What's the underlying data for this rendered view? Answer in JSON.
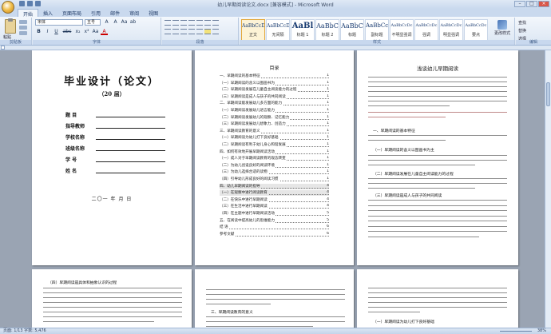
{
  "window": {
    "title": "幼儿早期阅读论文.docx [兼容模式] - Microsoft Word",
    "controls": [
      "–",
      "□",
      "×"
    ]
  },
  "tabs": [
    "开始",
    "插入",
    "页面布局",
    "引用",
    "邮件",
    "审阅",
    "视图"
  ],
  "ribbon": {
    "clipboard": {
      "paste_label": "粘贴",
      "group_label": "剪贴板"
    },
    "font": {
      "name": "宋体",
      "size": "五号",
      "group_label": "字体",
      "row1": [
        "A",
        "A",
        "Aa",
        "ab"
      ],
      "row2": [
        "B",
        "I",
        "U",
        "abc",
        "x₂",
        "x²",
        "Aa",
        "A"
      ]
    },
    "paragraph": {
      "group_label": "段落"
    },
    "styles": {
      "group_label": "样式",
      "items": [
        {
          "sample": "AaBbCcDc",
          "name": "正文"
        },
        {
          "sample": "AaBbCcDc",
          "name": "无间隔"
        },
        {
          "sample": "AaBl",
          "name": "标题 1"
        },
        {
          "sample": "AaBbC",
          "name": "标题 2"
        },
        {
          "sample": "AaBbC",
          "name": "标题"
        },
        {
          "sample": "AaBbCcl",
          "name": "副标题"
        },
        {
          "sample": "AaBbCcDc",
          "name": "不明显强调"
        },
        {
          "sample": "AaBbCcDc",
          "name": "强调"
        },
        {
          "sample": "AaBbCcDc",
          "name": "明显强调"
        },
        {
          "sample": "AaBbCcDc",
          "name": "要点"
        },
        {
          "sample": "AaBbCcDc",
          "name": "引用"
        },
        {
          "sample": "AaBbCcDc",
          "name": "明显引用"
        },
        {
          "sample": "AaBbCcDc",
          "name": "不明显参考"
        },
        {
          "sample": "AaBbCcDc",
          "name": "明显参考"
        },
        {
          "sample": "AaBbCcI",
          "name": "书籍标题"
        }
      ],
      "change_styles": "更改样式"
    },
    "editing": {
      "group_label": "编辑",
      "items": [
        "查找",
        "替换",
        "选择"
      ]
    }
  },
  "cover": {
    "title": "毕业设计（论文）",
    "year": "（20 届）",
    "fields": [
      "题    目",
      "指导教师",
      "学校名称",
      "班级名称",
      "学    号",
      "姓    名"
    ],
    "date": "二〇一  年    月    日"
  },
  "toc": {
    "title": "目录",
    "items": [
      {
        "text": "一、早期阅读的基本特征",
        "page": "1"
      },
      {
        "text": "（一）早期阅读的含义以图画书为",
        "page": "1"
      },
      {
        "text": "（二）早期阅读发展在儿童自主阅读能力的过程",
        "page": "1"
      },
      {
        "text": "（三）早期阅读是成人与孩子的共同阅读",
        "page": "1"
      },
      {
        "text": "二、早期阅读能发展幼儿多方面的能力",
        "page": "1"
      },
      {
        "text": "（一）早期阅读发展幼儿语言能力",
        "page": "1"
      },
      {
        "text": "（二）早期阅读发展幼儿的观察、记忆能力",
        "page": "1"
      },
      {
        "text": "（三）早期阅读发展幼儿想象力、创造力",
        "page": "1"
      },
      {
        "text": "三、早期阅读教育的意义",
        "page": "1"
      },
      {
        "text": "（一）早期阅读为幼儿打下良好基础",
        "page": "1"
      },
      {
        "text": "（二）早期阅读有利于幼儿身心和谐发展",
        "page": "1"
      },
      {
        "text": "四、如何有效地开展早期阅读活动",
        "page": "1"
      },
      {
        "text": "（一）成人对于早期阅读教育的观念转变",
        "page": "1"
      },
      {
        "text": "（二）为幼儿创设良好的阅读环境",
        "page": "1"
      },
      {
        "text": "（三）为幼儿选择合适的读物",
        "page": "1"
      },
      {
        "text": "（四）引导幼儿形成良好的阅读习惯",
        "page": "1"
      },
      {
        "text": "四、幼儿早期阅读的指导",
        "page": "4"
      },
      {
        "text": "（一）在观察中进行阅读教育",
        "page": "4"
      },
      {
        "text": "（二）在快乐中进行早期阅读",
        "page": "4"
      },
      {
        "text": "（三）在生活中进行早期阅读",
        "page": "4"
      },
      {
        "text": "（四）在主题中进行早期阅读活动",
        "page": "5"
      },
      {
        "text": "五、在阅读中提高幼儿的思维能力",
        "page": "5"
      },
      {
        "text": "结    语",
        "page": "6"
      },
      {
        "text": "参考文献",
        "page": "6"
      }
    ]
  },
  "article": {
    "title": "浅谈幼儿早期阅读",
    "headings": [
      "一、早期阅读的基本特征",
      "（一）早期阅读的含义以图画书为主",
      "（二）早期阅读发展在儿童自主阅读能力的过程",
      "（三）早期阅读是成人与孩子的共同阅读"
    ],
    "page4_heading": "（四）早期阅读是具体和抽象认识的过程",
    "page5_heading": "三、早期阅读教育的意义",
    "page6_heading": "（一）早期阅读为幼儿打下良好基础"
  },
  "status": {
    "left": "页面: 1/13   字数: 5,476",
    "zoom": "38%"
  }
}
